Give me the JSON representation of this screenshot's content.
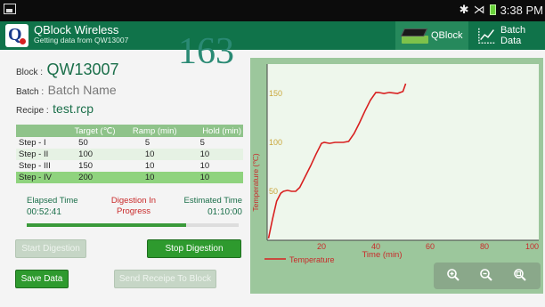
{
  "status_bar": {
    "time": "3:38 PM"
  },
  "app": {
    "title": "QBlock Wireless",
    "subtitle": "Getting data from QW13007",
    "nav": {
      "qblock_label": "QBlock",
      "batch_label": "Batch Data"
    }
  },
  "block": {
    "label": "Block :",
    "value": "QW13007"
  },
  "batch": {
    "label": "Batch :",
    "value": "Batch Name"
  },
  "recipe": {
    "label": "Recipe :",
    "value": "test.rcp"
  },
  "current_reading": "163",
  "steps": {
    "headers": [
      "",
      "Target (℃)",
      "Ramp (min)",
      "Hold (min)"
    ],
    "rows": [
      {
        "name": "Step - I",
        "target": "50",
        "ramp": "5",
        "hold": "5"
      },
      {
        "name": "Step - II",
        "target": "100",
        "ramp": "10",
        "hold": "10"
      },
      {
        "name": "Step - III",
        "target": "150",
        "ramp": "10",
        "hold": "10"
      },
      {
        "name": "Step - IV",
        "target": "200",
        "ramp": "10",
        "hold": "10"
      }
    ],
    "active_index": 3
  },
  "elapsed": {
    "label": "Elapsed Time",
    "value": "00:52:41"
  },
  "digestion_status": {
    "line1": "Digestion In",
    "line2": "Progress"
  },
  "estimated": {
    "label": "Estimated Time",
    "value": "01:10:00"
  },
  "progress_fraction": 0.75,
  "buttons": {
    "start": {
      "label": "Start Digestion",
      "enabled": false
    },
    "stop": {
      "label": "Stop Digestion",
      "enabled": true
    },
    "save": {
      "label": "Save Data",
      "enabled": true
    },
    "send": {
      "label": "Send Receipe To Block",
      "enabled": false
    }
  },
  "chart_data": {
    "type": "line",
    "xlabel": "Time (min)",
    "ylabel": "Temperature (℃)",
    "xlim": [
      0,
      100
    ],
    "ylim": [
      0,
      180
    ],
    "x_ticks": [
      20,
      40,
      60,
      80,
      100
    ],
    "y_ticks": [
      50,
      100,
      150
    ],
    "legend_position": "bottom-left",
    "series": [
      {
        "name": "Temperature",
        "color": "#d82020",
        "points": [
          [
            0.5,
            2
          ],
          [
            2,
            22
          ],
          [
            3.5,
            40
          ],
          [
            5,
            48
          ],
          [
            6,
            50
          ],
          [
            7.5,
            51
          ],
          [
            9,
            50
          ],
          [
            10.5,
            50
          ],
          [
            12,
            54
          ],
          [
            14,
            65
          ],
          [
            16,
            76
          ],
          [
            18,
            88
          ],
          [
            20,
            99
          ],
          [
            21,
            100
          ],
          [
            23,
            99
          ],
          [
            25,
            100
          ],
          [
            28,
            100
          ],
          [
            30,
            101
          ],
          [
            32,
            109
          ],
          [
            34,
            120
          ],
          [
            36,
            132
          ],
          [
            38,
            143
          ],
          [
            40,
            151
          ],
          [
            41,
            151
          ],
          [
            43,
            150
          ],
          [
            45,
            151
          ],
          [
            48,
            150
          ],
          [
            50,
            152
          ],
          [
            51,
            160
          ]
        ]
      }
    ]
  },
  "colors": {
    "accent_green": "#10734a",
    "chart_background": "#eef7ec",
    "chart_frame": "#9cc79c"
  }
}
